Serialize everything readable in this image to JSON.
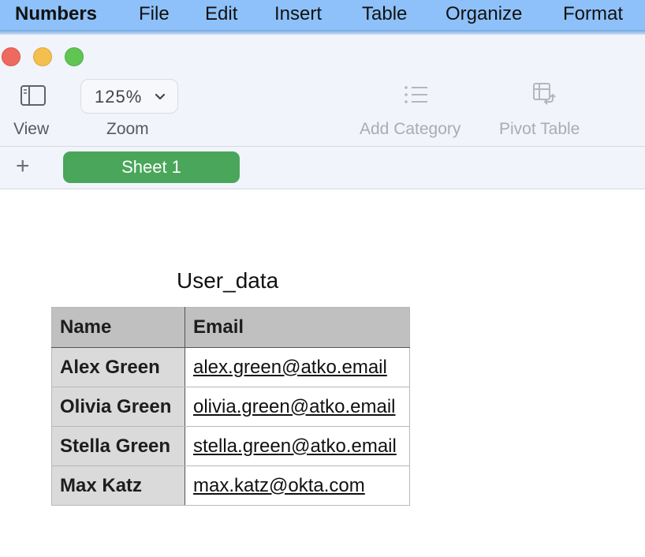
{
  "menubar": {
    "app": "Numbers",
    "items": [
      "File",
      "Edit",
      "Insert",
      "Table",
      "Organize",
      "Format"
    ]
  },
  "toolbar": {
    "view_label": "View",
    "zoom_label": "Zoom",
    "zoom_value": "125%",
    "add_category_label": "Add Category",
    "pivot_table_label": "Pivot Table"
  },
  "tabs": {
    "add_symbol": "+",
    "sheets": [
      "Sheet 1"
    ]
  },
  "table": {
    "title": "User_data",
    "headers": [
      "Name",
      "Email"
    ],
    "rows": [
      {
        "name": "Alex Green",
        "email": "alex.green@atko.email"
      },
      {
        "name": "Olivia Green",
        "email": "olivia.green@atko.email"
      },
      {
        "name": "Stella Green",
        "email": "stella.green@atko.email"
      },
      {
        "name": "Max Katz",
        "email": "max.katz@okta.com"
      }
    ]
  },
  "colors": {
    "menubar": "#8ec1f9",
    "sheet_tab": "#4aa65a",
    "header_fill": "#bfc0bf",
    "name_fill": "#dadada"
  }
}
